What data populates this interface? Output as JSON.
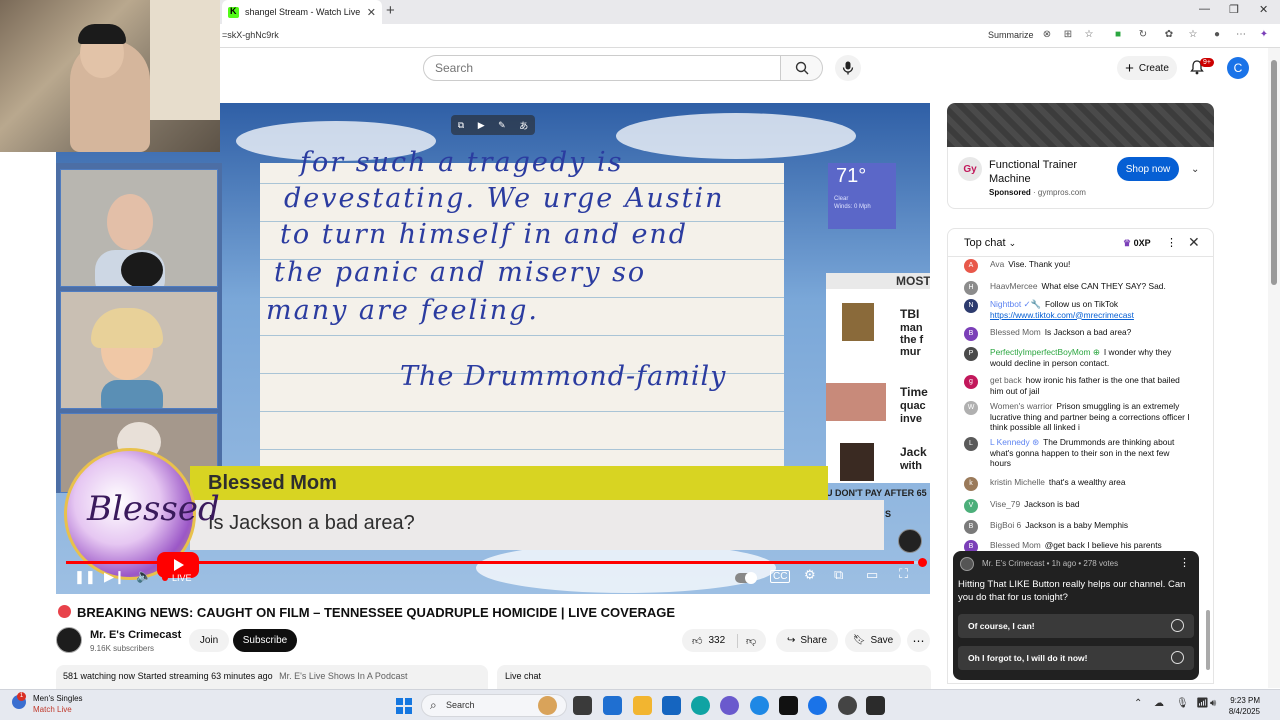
{
  "browser": {
    "tab_title": "shangel Stream - Watch Live on K",
    "url": "=skX-ghNc9rk",
    "summarize": "Summarize"
  },
  "header": {
    "search_placeholder": "Search",
    "create_label": "Create",
    "notifications_badge": "9+",
    "avatar_letter": "C"
  },
  "video": {
    "letter_lines": [
      "for such a tragedy is",
      "devestating. We urge Austin",
      "to turn himself in and end",
      "the panic and misery so",
      "many are feeling."
    ],
    "signature": "The Drummond-family",
    "weather_temp": "71°",
    "weather_sub1": "Clear",
    "weather_sub2": "Winds: 0 Mph",
    "news_header": "MOST",
    "news_items": [
      {
        "lines": [
          "TBI",
          "man",
          "the f",
          "mur"
        ]
      },
      {
        "lines": [
          "Time",
          "quac",
          "inve"
        ]
      },
      {
        "lines": [
          "Jack",
          "with"
        ]
      }
    ],
    "dont_pay": "U DON'T PAY AFTER 65",
    "tiny_s": "S",
    "lower_third_name": "Blessed Mom",
    "lower_third_text": "Is Jackson a bad area?",
    "logo_text": "Blessed",
    "live_label": "LIVE",
    "progress_fraction": 0.99
  },
  "details": {
    "title": "BREAKING NEWS: CAUGHT ON FILM – TENNESSEE QUADRUPLE HOMICIDE | LIVE COVERAGE",
    "channel_name": "Mr. E's Crimecast",
    "subscribers": "9.16K subscribers",
    "join_label": "Join",
    "subscribe_label": "Subscribe",
    "like_count": "332",
    "share_label": "Share",
    "save_label": "Save",
    "watching": "581 watching now",
    "started": "Started streaming 63 minutes ago",
    "tag": "Mr. E's Live Shows In A Podcast",
    "live_chat_tab": "Live chat"
  },
  "ad": {
    "logo": "Gy",
    "title": "Functional Trainer Machine",
    "sponsored": "Sponsored",
    "domain": "gympros.com",
    "cta": "Shop now"
  },
  "chat": {
    "mode_label": "Top chat",
    "xp": "0XP",
    "messages": [
      {
        "initial": "A",
        "color": "#e8584a",
        "author": "Ava",
        "text": "Vise. Thank you!",
        "style": ""
      },
      {
        "initial": "H",
        "color": "#8c8c8c",
        "author": "HaavMercee",
        "text": "What else CAN THEY SAY? Sad.",
        "style": ""
      },
      {
        "initial": "N",
        "color": "#2d3b6e",
        "author": "Nightbot ✓🔧",
        "text": "Follow us on TikTok",
        "link": "https://www.tiktok.com/@mrecrimecast",
        "style": "blue"
      },
      {
        "initial": "B",
        "color": "#7b3fb8",
        "author": "Blessed Mom",
        "text": "Is Jackson a bad area?",
        "style": ""
      },
      {
        "initial": "P",
        "color": "#4a4a4a",
        "author": "PerfectlyImperfectBoyMom ⊕",
        "text": "I wonder why they would decline in person contact.",
        "style": "green"
      },
      {
        "initial": "g",
        "color": "#c2185b",
        "author": "get back",
        "text": "how ironic his father is the one that bailed him out of jail",
        "style": ""
      },
      {
        "initial": "W",
        "color": "#b0b0b0",
        "author": "Women's warrior",
        "text": "Prison smuggling is an extremely lucrative thing and partner being a corrections officer I think possible all linked i",
        "style": ""
      },
      {
        "initial": "L",
        "color": "#5a5a5a",
        "author": "L Kennedy ⊛",
        "text": "The Drummonds are thinking about what's gonna happen to their son in the next few hours",
        "style": "blue"
      },
      {
        "initial": "k",
        "color": "#9a7a5a",
        "author": "kristin Michelle",
        "text": "that's a wealthy area",
        "style": ""
      },
      {
        "initial": "V",
        "color": "#4caf7a",
        "author": "Vise_79",
        "text": "Jackson is bad",
        "style": ""
      },
      {
        "initial": "B",
        "color": "#7a7a7a",
        "author": "BigBoi 6",
        "text": "Jackson is a baby Memphis",
        "style": ""
      },
      {
        "initial": "B",
        "color": "#7b3fb8",
        "author": "Blessed Mom",
        "text": "@get back I believe his parents",
        "style": ""
      }
    ]
  },
  "poll": {
    "meta": "Mr. E's Crimecast • 1h ago • 278 votes",
    "question": "Hitting That LIKE Button really helps our channel. Can you do that for us tonight?",
    "options": [
      "Of course, I can!",
      "Oh I forgot to, I will do it now!"
    ]
  },
  "taskbar": {
    "weather_title": "Men's Singles",
    "weather_sub": "Match Live",
    "weather_badge": "1",
    "search": "Search",
    "time": "9:23 PM",
    "date": "8/4/2025"
  },
  "colors": {
    "youtube_red": "#ff0000",
    "accent_blue": "#065fd4",
    "lower_third_yellow": "#d8d422"
  }
}
